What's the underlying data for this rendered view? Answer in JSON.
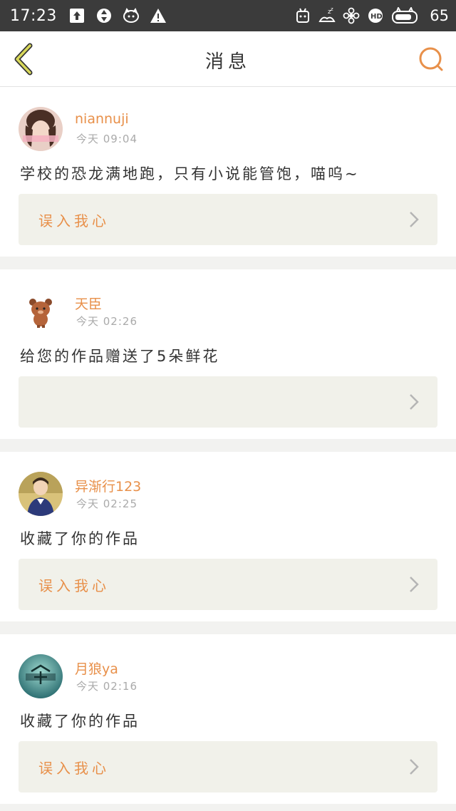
{
  "status_bar": {
    "time": "17:23",
    "battery_level": "65",
    "left_icons": [
      "upload-icon",
      "sync-icon",
      "cat-icon",
      "warning-icon"
    ],
    "right_icons": [
      "robot-icon",
      "sleep-icon",
      "flower-icon",
      "hd-icon",
      "cat-battery-icon"
    ]
  },
  "header": {
    "title": "消息",
    "accent_color": "#e8904a"
  },
  "messages": [
    {
      "username": "niannuji",
      "time": "今天  09:04",
      "content": "学校的恐龙满地跑，只有小说能管饱，喵呜~",
      "work_title": "误入我心"
    },
    {
      "username": "天臣",
      "time": "今天  02:26",
      "content": "给您的作品赠送了5朵鲜花",
      "work_title": ""
    },
    {
      "username": "异渐行123",
      "time": "今天  02:25",
      "content": "收藏了你的作品",
      "work_title": "误入我心"
    },
    {
      "username": "月狼ya",
      "time": "今天  02:16",
      "content": "收藏了你的作品",
      "work_title": "误入我心"
    }
  ]
}
